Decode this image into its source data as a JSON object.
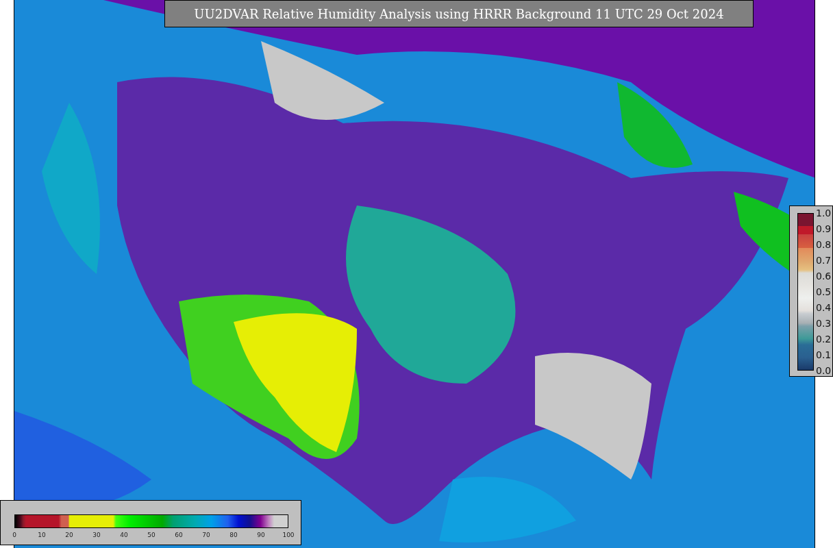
{
  "title": "UU2DVAR Relative Humidity Analysis using HRRR Background 11 UTC 29 Oct 2024",
  "humidity_colorbar": {
    "ticks": [
      "0",
      "10",
      "20",
      "30",
      "40",
      "50",
      "60",
      "70",
      "80",
      "90",
      "100"
    ]
  },
  "station_colorbar": {
    "ticks": [
      "1.0",
      "0.9",
      "0.8",
      "0.7",
      "0.6",
      "0.5",
      "0.4",
      "0.3",
      "0.2",
      "0.1",
      "0.0"
    ]
  }
}
